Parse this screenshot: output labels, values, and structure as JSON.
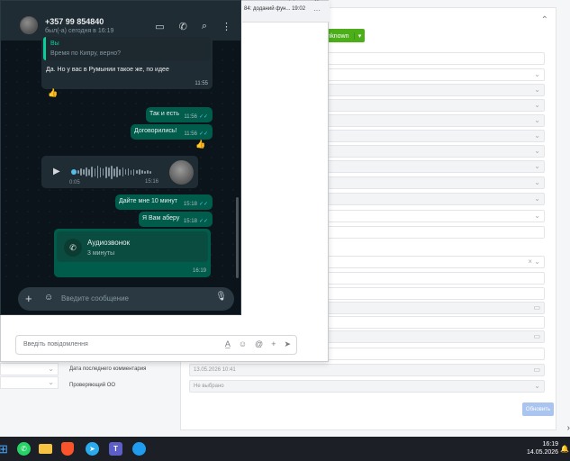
{
  "crm": {
    "status_label": "Unknown",
    "field_rows": [
      {
        "label": "Дата последнего комментария",
        "value": "13.05.2026 10:41"
      },
      {
        "label": "Проверяющий ОО",
        "value": "Не выбрано"
      }
    ],
    "refresh_label": "Обновить"
  },
  "mid_window": {
    "tab_title": "84: доданий фун... 19:02",
    "tab_more": "···",
    "composer_placeholder": "Введіть повідомлення"
  },
  "whatsapp": {
    "contact_name": "+357 99 854840",
    "contact_status": "был(-а) сегодня в 16:19",
    "quote_name": "Вы",
    "quote_text": "Время по Кипру, верно?",
    "messages": [
      {
        "dir": "in",
        "text": "Да. Но у вас в Румынии такое же, по идее",
        "time": "11:55"
      },
      {
        "dir": "out",
        "text": "Так и есть",
        "time": "11:56"
      },
      {
        "dir": "out",
        "text": "Договорились!",
        "time": "11:56"
      },
      {
        "dir": "out",
        "text": "Дайте мне 10 минут",
        "time": "15:18"
      },
      {
        "dir": "out",
        "text": "Я Вам аберу",
        "time": "15:18"
      }
    ],
    "voice": {
      "duration": "0:05",
      "time": "15:16"
    },
    "call": {
      "title": "Аудиозвонок",
      "duration": "3 минуты",
      "time": "16:19"
    },
    "input_placeholder": "Введите сообщение",
    "colors": {
      "bg": "#0b141a",
      "incoming": "#202c33",
      "outgoing": "#005c4b",
      "accent": "#06cf9c"
    }
  },
  "taskbar": {
    "time": "16:19",
    "date": "14.05.2026",
    "apps": [
      "windows-start",
      "whatsapp",
      "file-explorer",
      "brave",
      "telegram",
      "teams",
      "edge"
    ]
  }
}
